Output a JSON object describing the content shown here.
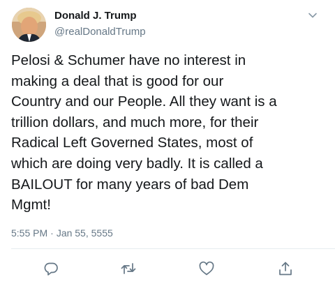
{
  "tweet": {
    "author_name": "Donald J. Trump",
    "author_handle": "@realDonaldTrump",
    "text": "Pelosi & Schumer have no interest in\nmaking a deal that is good for our\nCountry and our People. All they want is a\ntrillion dollars, and much more, for their\nRadical Left Governed States, most of\nwhich are doing very badly. It is called a\nBAILOUT for many years of bad Dem\nMgmt!",
    "time": "5:55 PM",
    "separator": "·",
    "date": "Jan 55, 5555"
  },
  "icons": {
    "menu": "chevron-down-icon",
    "reply": "reply-icon",
    "retweet": "retweet-icon",
    "like": "heart-icon",
    "share": "share-icon"
  },
  "colors": {
    "text": "#14171a",
    "secondary": "#657786",
    "icon": "#657786",
    "divider": "#e6ecf0"
  }
}
